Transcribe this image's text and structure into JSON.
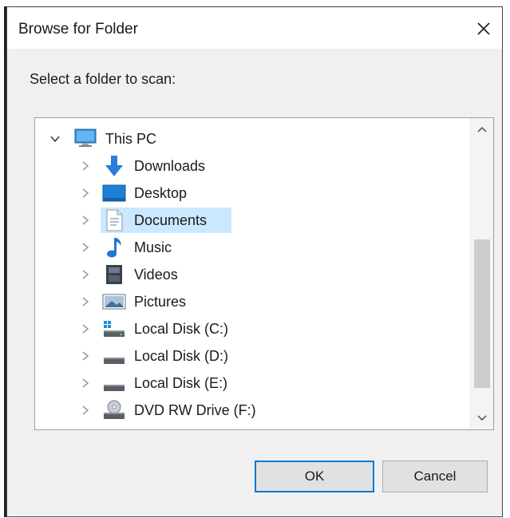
{
  "dialog": {
    "title": "Browse for Folder",
    "prompt": "Select a folder to scan:",
    "ok_label": "OK",
    "cancel_label": "Cancel",
    "accent_color": "#0078d7",
    "selection_color": "#cce8ff"
  },
  "tree": {
    "root": {
      "label": "This PC",
      "icon": "computer-icon",
      "expanded": true
    },
    "items": [
      {
        "label": "Downloads",
        "icon": "downloads-icon"
      },
      {
        "label": "Desktop",
        "icon": "desktop-icon"
      },
      {
        "label": "Documents",
        "icon": "documents-icon",
        "selected": true
      },
      {
        "label": "Music",
        "icon": "music-icon"
      },
      {
        "label": "Videos",
        "icon": "videos-icon"
      },
      {
        "label": "Pictures",
        "icon": "pictures-icon"
      },
      {
        "label": "Local Disk (C:)",
        "icon": "system-drive-icon"
      },
      {
        "label": "Local Disk (D:)",
        "icon": "drive-icon"
      },
      {
        "label": "Local Disk (E:)",
        "icon": "drive-icon"
      },
      {
        "label": "DVD RW Drive (F:)",
        "icon": "dvd-drive-icon"
      }
    ]
  }
}
